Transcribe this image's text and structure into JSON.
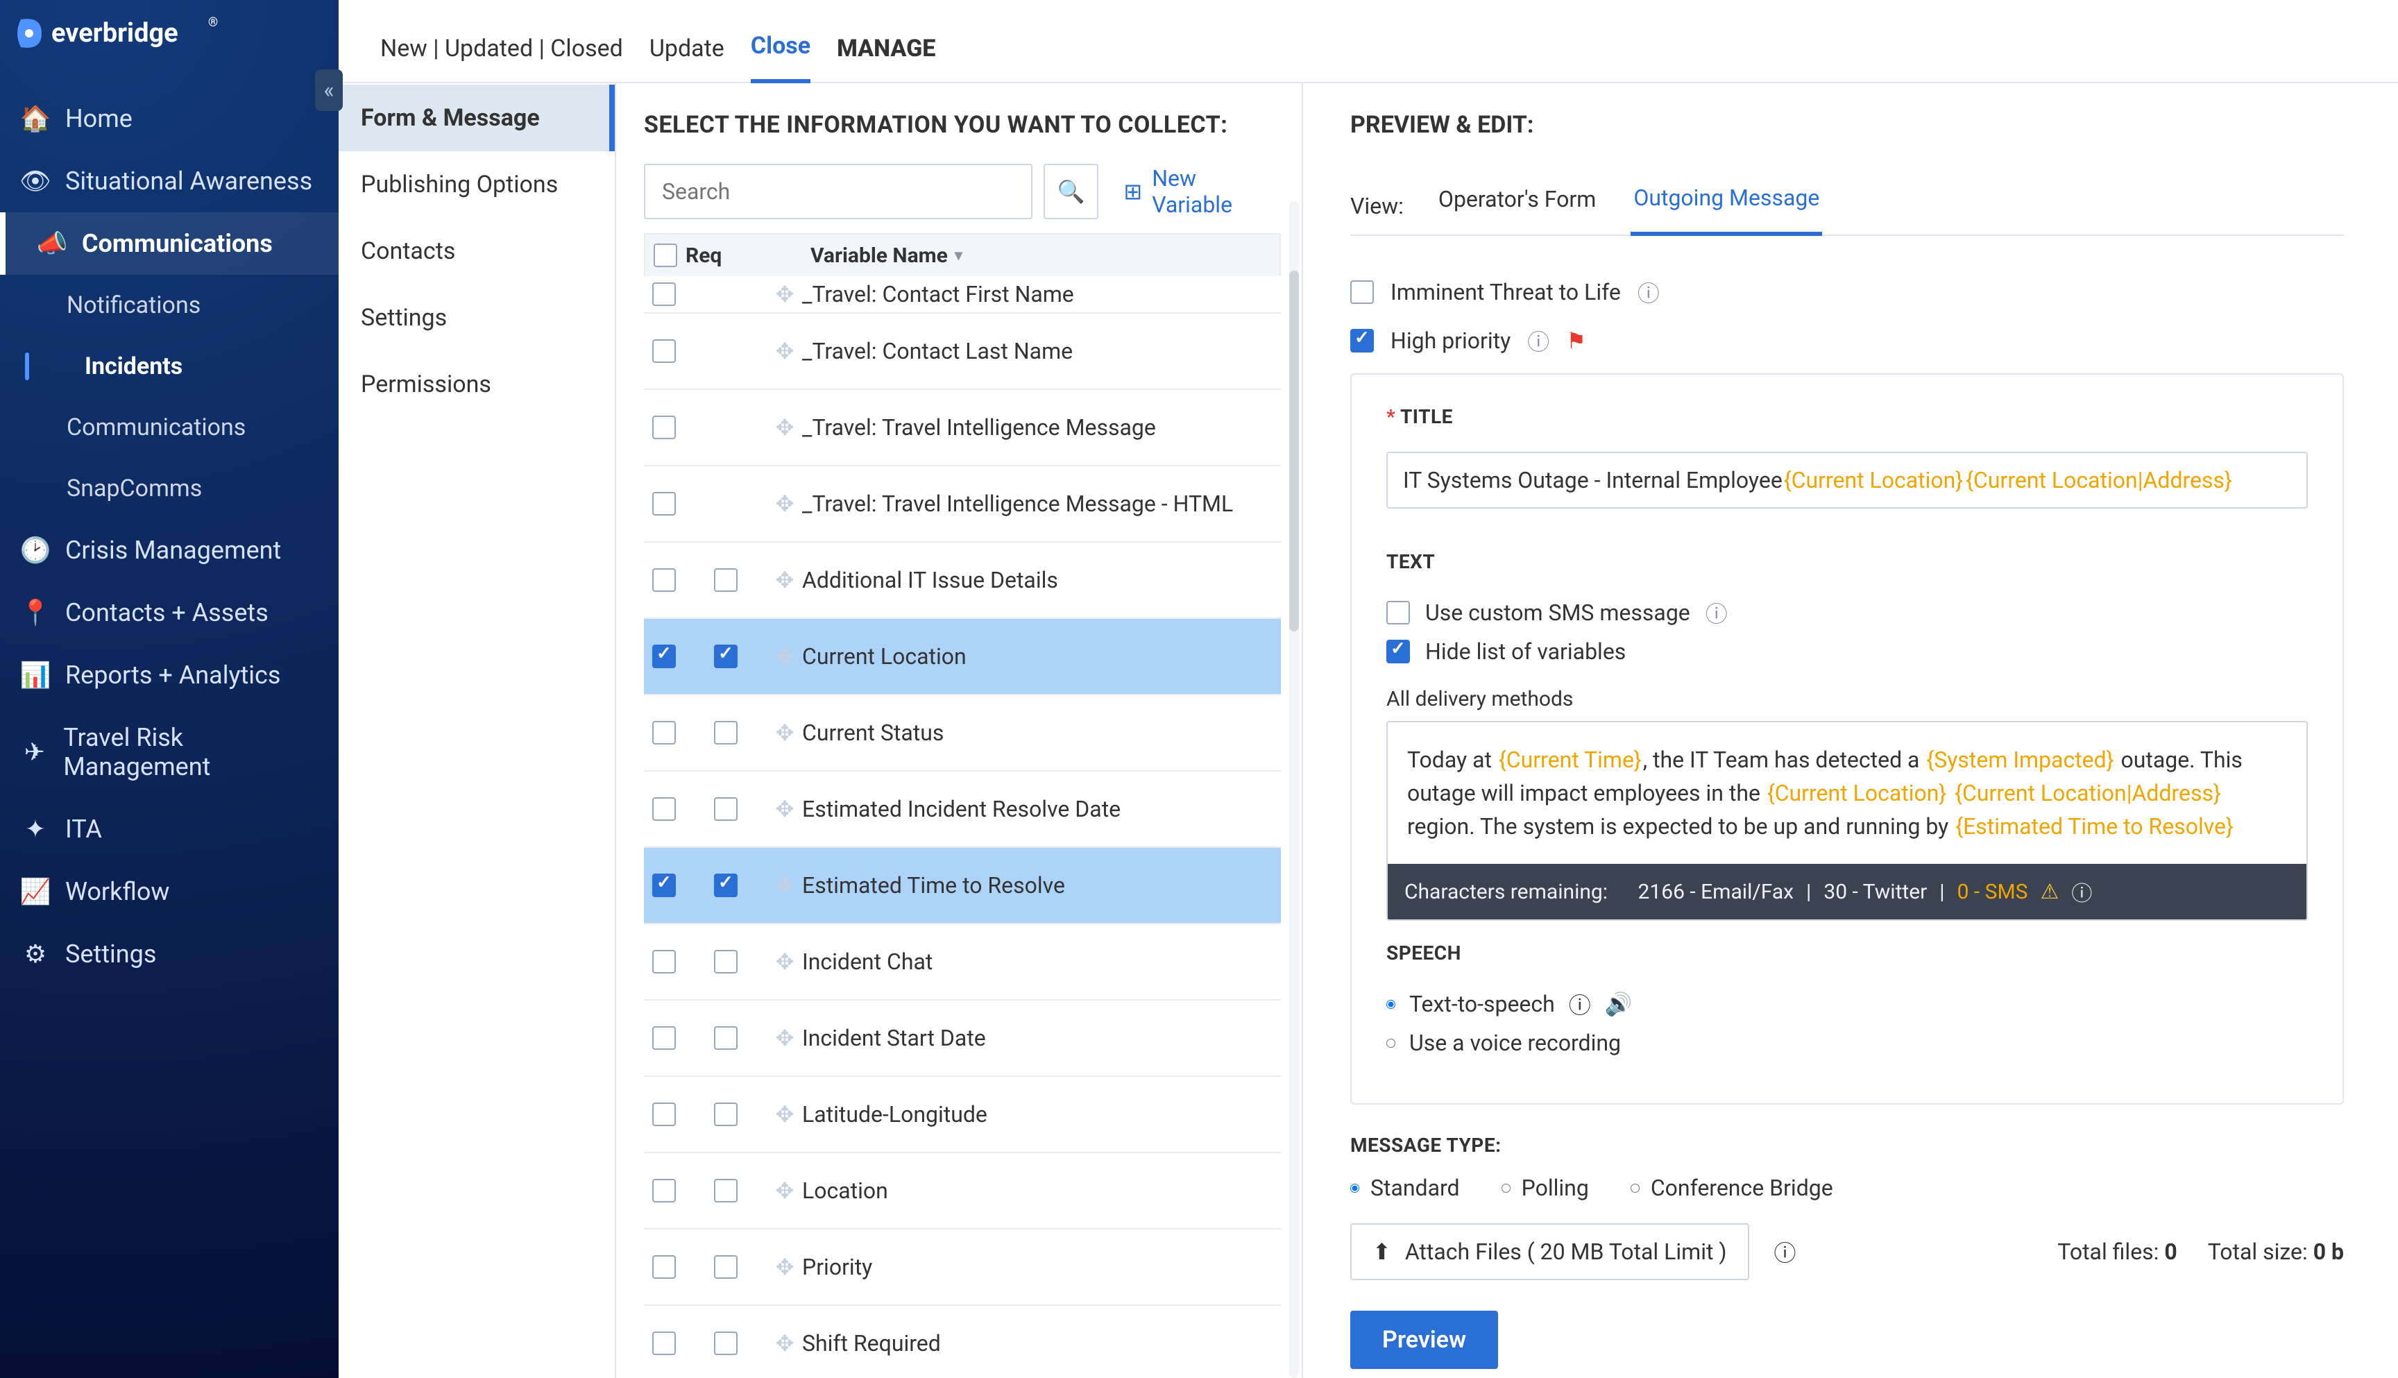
{
  "brand": "Everbridge",
  "sidebar": {
    "items": [
      {
        "icon": "home",
        "label": "Home"
      },
      {
        "icon": "eye",
        "label": "Situational Awareness"
      },
      {
        "icon": "megaphone",
        "label": "Communications",
        "section": true,
        "children": [
          {
            "label": "Notifications"
          },
          {
            "label": "Incidents",
            "active": true
          },
          {
            "label": "Communications"
          },
          {
            "label": "SnapComms"
          }
        ]
      },
      {
        "icon": "clock",
        "label": "Crisis Management"
      },
      {
        "icon": "pin",
        "label": "Contacts + Assets"
      },
      {
        "icon": "chart",
        "label": "Reports + Analytics"
      },
      {
        "icon": "plane",
        "label": "Travel Risk Management"
      },
      {
        "icon": "ita",
        "label": "ITA"
      },
      {
        "icon": "workflow",
        "label": "Workflow"
      },
      {
        "icon": "gear",
        "label": "Settings"
      }
    ]
  },
  "topbar": [
    {
      "label": "New | Updated | Closed"
    },
    {
      "label": "Update"
    },
    {
      "label": "Close",
      "active": true
    },
    {
      "label": "MANAGE",
      "bold": true
    }
  ],
  "settingsNav": [
    {
      "label": "Form & Message",
      "active": true
    },
    {
      "label": "Publishing Options"
    },
    {
      "label": "Contacts"
    },
    {
      "label": "Settings"
    },
    {
      "label": "Permissions"
    }
  ],
  "collect": {
    "heading": "SELECT THE INFORMATION YOU WANT TO COLLECT:",
    "searchPlaceholder": "Search",
    "newVariable": "New Variable",
    "columns": {
      "req": "Req",
      "name": "Variable Name"
    },
    "rows": [
      {
        "chk": false,
        "req": false,
        "reqHidden": true,
        "name": "_Travel: Contact First Name",
        "truncated": true
      },
      {
        "chk": false,
        "req": false,
        "reqHidden": true,
        "name": "_Travel: Contact Last Name"
      },
      {
        "chk": false,
        "req": false,
        "reqHidden": true,
        "name": "_Travel: Travel Intelligence Message"
      },
      {
        "chk": false,
        "req": false,
        "reqHidden": true,
        "name": "_Travel: Travel Intelligence Message - HTML"
      },
      {
        "chk": false,
        "req": false,
        "name": "Additional IT Issue Details"
      },
      {
        "chk": true,
        "req": true,
        "name": "Current Location",
        "selected": true
      },
      {
        "chk": false,
        "req": false,
        "name": "Current Status"
      },
      {
        "chk": false,
        "req": false,
        "name": "Estimated Incident Resolve Date"
      },
      {
        "chk": true,
        "req": true,
        "name": "Estimated Time to Resolve",
        "selected": true
      },
      {
        "chk": false,
        "req": false,
        "name": "Incident Chat"
      },
      {
        "chk": false,
        "req": false,
        "name": "Incident Start Date"
      },
      {
        "chk": false,
        "req": false,
        "name": "Latitude-Longitude"
      },
      {
        "chk": false,
        "req": false,
        "name": "Location"
      },
      {
        "chk": false,
        "req": false,
        "name": "Priority"
      },
      {
        "chk": false,
        "req": false,
        "name": "Shift Required"
      }
    ]
  },
  "preview": {
    "heading": "PREVIEW & EDIT:",
    "viewLabel": "View:",
    "tabs": [
      {
        "label": "Operator's Form"
      },
      {
        "label": "Outgoing Message",
        "active": true
      }
    ],
    "flags": {
      "imminent": {
        "label": "Imminent Threat to Life",
        "checked": false
      },
      "high": {
        "label": "High priority",
        "checked": true
      }
    },
    "title": {
      "label": "TITLE",
      "plain": "IT Systems Outage - Internal Employee ",
      "token1": "{Current Location}",
      "token2": "{Current Location|Address}"
    },
    "text": {
      "label": "TEXT",
      "customSms": {
        "label": "Use custom SMS message",
        "checked": false
      },
      "hideVars": {
        "label": "Hide list of variables",
        "checked": true
      },
      "deliveryLabel": "All delivery methods",
      "bodyParts": [
        "Today at ",
        {
          "t": "{Current Time}"
        },
        ", the IT Team has detected a ",
        {
          "t": "{System Impacted}"
        },
        " outage.  This outage will impact employees in the ",
        {
          "t": "{Current Location}"
        },
        " ",
        {
          "t": "{Current Location|Address}"
        },
        " region.  The system is expected to be up and running by ",
        {
          "t": "{Estimated Time to Resolve}"
        }
      ],
      "status": {
        "prefix": "Characters remaining:",
        "email": "2166 - Email/Fax",
        "twitter": "30 - Twitter",
        "sms": "0 - SMS"
      }
    },
    "speech": {
      "label": "SPEECH",
      "tts": "Text-to-speech",
      "rec": "Use a voice recording"
    },
    "messageType": {
      "label": "MESSAGE TYPE:",
      "options": [
        "Standard",
        "Polling",
        "Conference Bridge"
      ],
      "attach": "Attach Files ( 20 MB Total Limit )",
      "totals": {
        "filesLabel": "Total files:",
        "files": "0",
        "sizeLabel": "Total size:",
        "size": "0 b"
      }
    },
    "previewBtn": "Preview"
  }
}
